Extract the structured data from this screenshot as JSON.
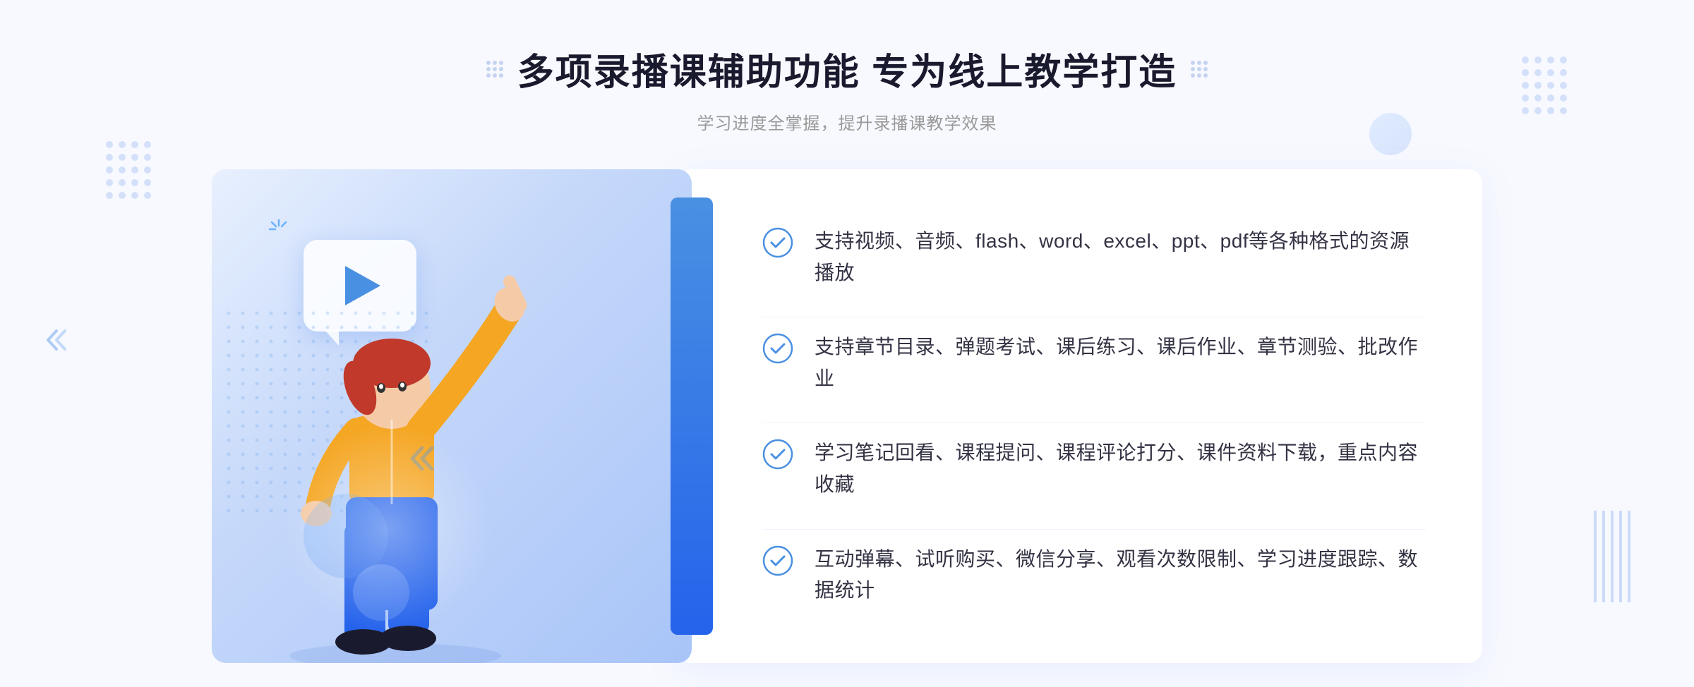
{
  "page": {
    "background_color": "#f5f7ff"
  },
  "header": {
    "title": "多项录播课辅助功能 专为线上教学打造",
    "subtitle": "学习进度全掌握，提升录播课教学效果",
    "dots_icon_left": "decorative-dots",
    "dots_icon_right": "decorative-dots"
  },
  "features": [
    {
      "id": 1,
      "text": "支持视频、音频、flash、word、excel、ppt、pdf等各种格式的资源播放",
      "icon": "check-circle-icon"
    },
    {
      "id": 2,
      "text": "支持章节目录、弹题考试、课后练习、课后作业、章节测验、批改作业",
      "icon": "check-circle-icon"
    },
    {
      "id": 3,
      "text": "学习笔记回看、课程提问、课程评论打分、课件资料下载，重点内容收藏",
      "icon": "check-circle-icon"
    },
    {
      "id": 4,
      "text": "互动弹幕、试听购买、微信分享、观看次数限制、学习进度跟踪、数据统计",
      "icon": "check-circle-icon"
    }
  ],
  "illustration": {
    "alt": "教学插图",
    "play_button": "play-icon"
  },
  "colors": {
    "primary_blue": "#4a90e2",
    "dark_blue": "#2563eb",
    "text_dark": "#1a1a2e",
    "text_medium": "#333344",
    "text_light": "#999999",
    "check_color": "#4a90e2",
    "bg_gradient_start": "#dde8fc",
    "bg_gradient_end": "#b8d0f8"
  }
}
